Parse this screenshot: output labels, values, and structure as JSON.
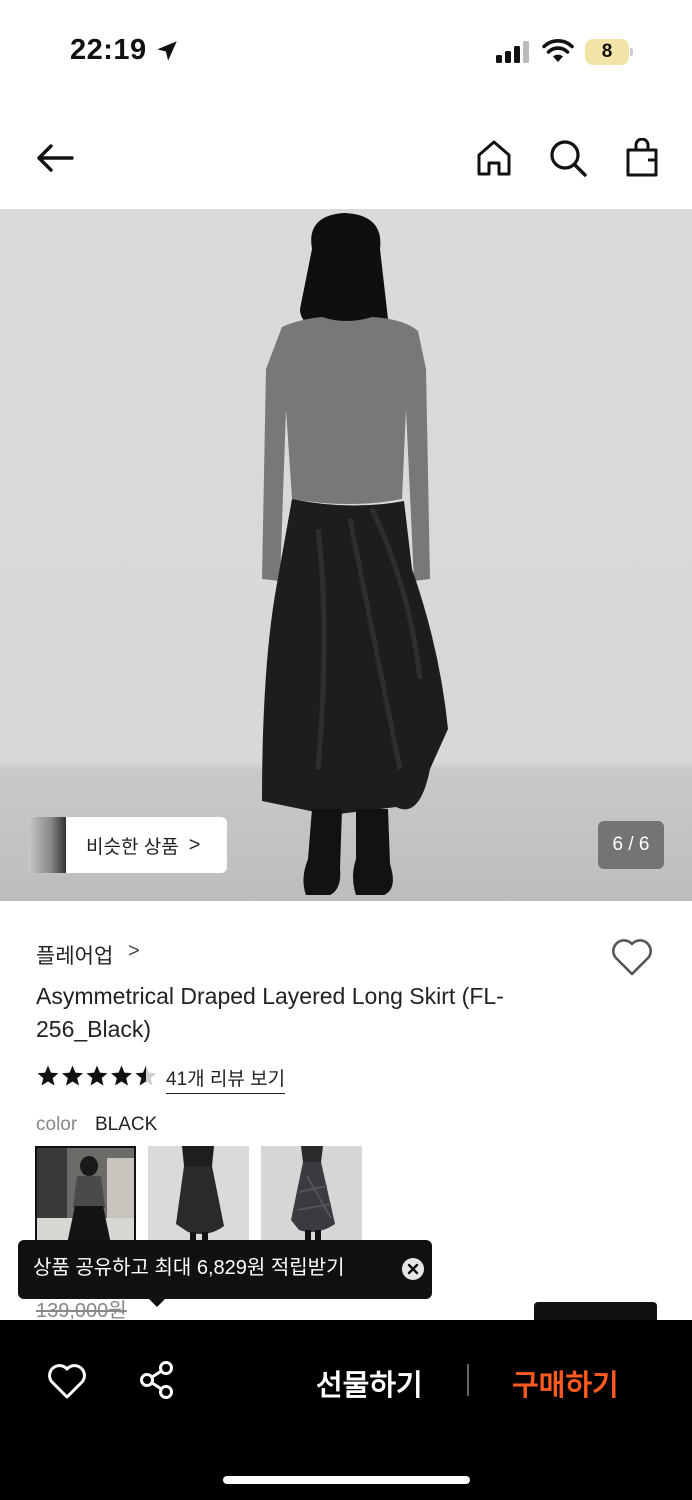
{
  "status_bar": {
    "time": "22:19",
    "battery": "8"
  },
  "hero": {
    "similar_label": "비슷한 상품",
    "similar_chevron": ">",
    "counter": "6 / 6"
  },
  "product": {
    "brand": "플레어업",
    "brand_chevron": ">",
    "title": "Asymmetrical Draped Layered Long Skirt (FL-256_Black)",
    "rating": 4.5,
    "reviews_link": "41개 리뷰 보기",
    "color_label": "color",
    "color_value": "BLACK",
    "old_price": "139,000원"
  },
  "toast": {
    "message": "상품 공유하고 최대 6,829원 적립받기"
  },
  "bottom_bar": {
    "gift_label": "선물하기",
    "buy_label": "구매하기"
  },
  "colors": {
    "accent": "#ff5a1f",
    "bar": "#000000"
  }
}
